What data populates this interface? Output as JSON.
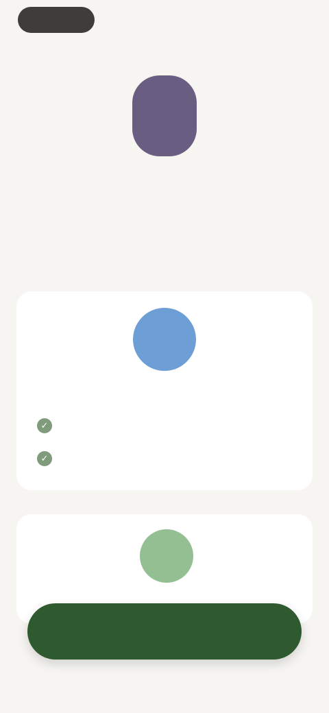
{
  "header": {
    "top_pill": ""
  },
  "intro": {
    "title": "",
    "subtitle": ""
  },
  "cards": [
    {
      "title": "",
      "features": [
        "",
        ""
      ]
    },
    {
      "title": ""
    }
  ],
  "actions": {
    "primary": ""
  }
}
